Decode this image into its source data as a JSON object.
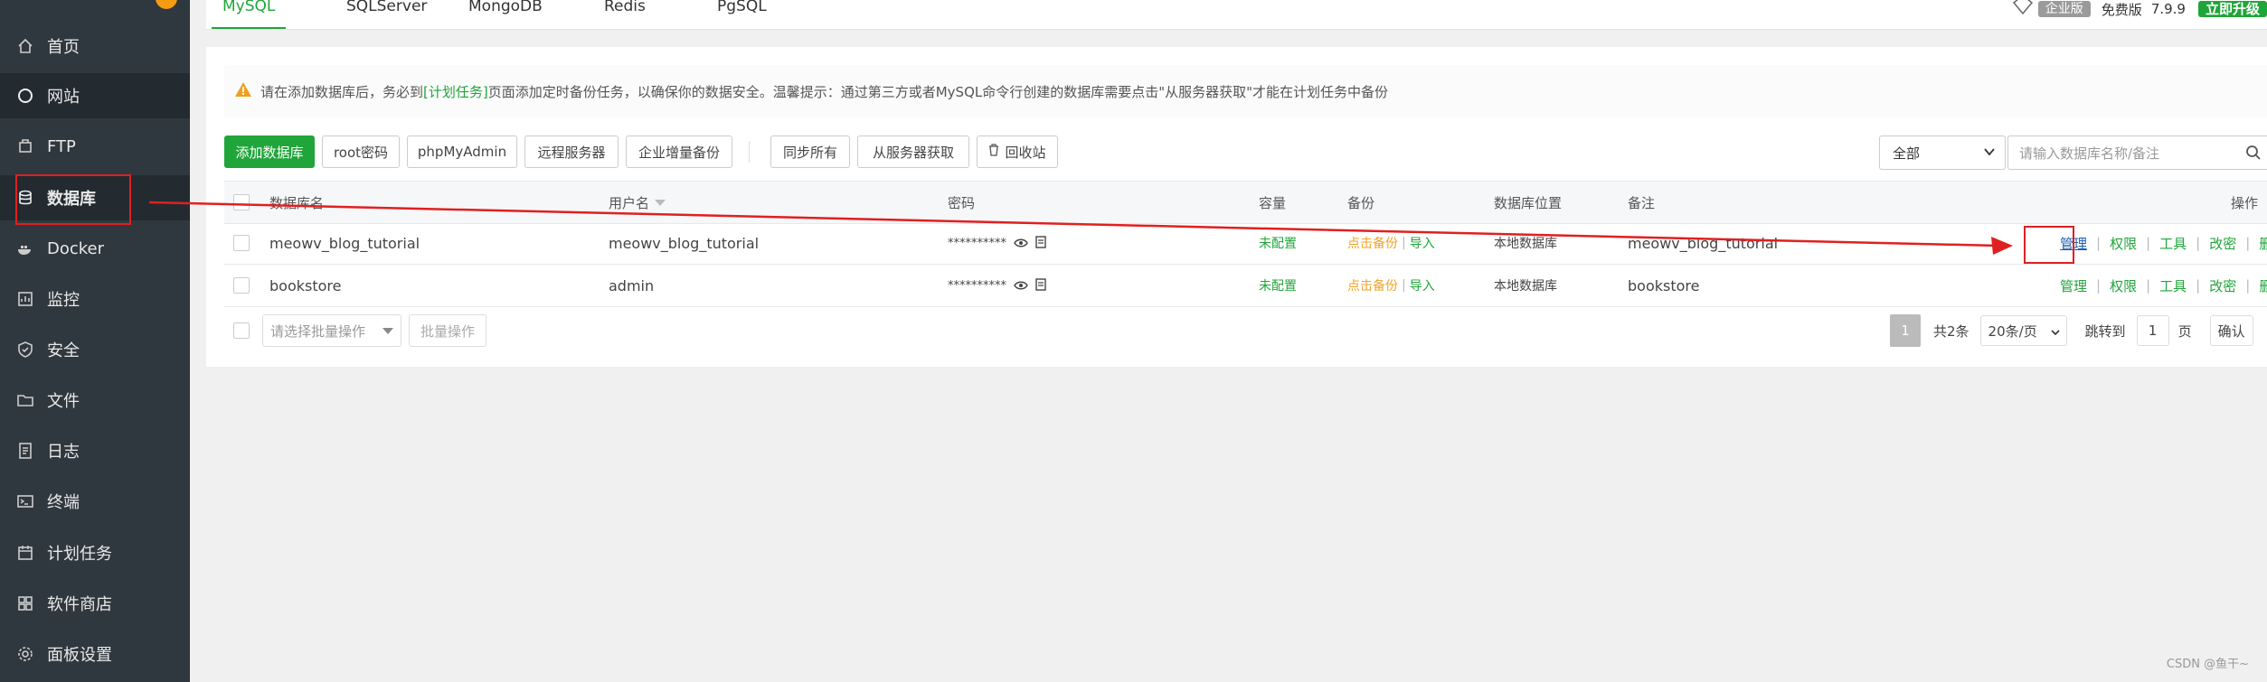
{
  "sidebar": {
    "items": [
      {
        "label": "首页",
        "icon": "home-icon"
      },
      {
        "label": "网站",
        "icon": "globe-icon"
      },
      {
        "label": "FTP",
        "icon": "ftp-icon"
      },
      {
        "label": "数据库",
        "icon": "database-icon"
      },
      {
        "label": "Docker",
        "icon": "docker-icon"
      },
      {
        "label": "监控",
        "icon": "monitor-icon"
      },
      {
        "label": "安全",
        "icon": "shield-icon"
      },
      {
        "label": "文件",
        "icon": "folder-icon"
      },
      {
        "label": "日志",
        "icon": "log-icon"
      },
      {
        "label": "终端",
        "icon": "terminal-icon"
      },
      {
        "label": "计划任务",
        "icon": "calendar-icon"
      },
      {
        "label": "软件商店",
        "icon": "apps-icon"
      },
      {
        "label": "面板设置",
        "icon": "gear-icon"
      }
    ]
  },
  "tabs": [
    "MySQL",
    "SQLServer",
    "MongoDB",
    "Redis",
    "PgSQL"
  ],
  "top_right": {
    "enterprise": "企业版",
    "free": "免费版",
    "version": "7.9.9",
    "upgrade": "立即升级"
  },
  "warning": {
    "before": "请在添加数据库后，务必到",
    "link": "[计划任务]",
    "after": "页面添加定时备份任务，以确保你的数据安全。温馨提示：通过第三方或者MySQL命令行创建的数据库需要点击\"从服务器获取\"才能在计划任务中备份"
  },
  "toolbar": {
    "add": "添加数据库",
    "root_pwd": "root密码",
    "phpmyadmin": "phpMyAdmin",
    "remote": "远程服务器",
    "incremental": "企业增量备份",
    "sync_all": "同步所有",
    "fetch": "从服务器获取",
    "recycle": "回收站",
    "filter_value": "全部",
    "search_placeholder": "请输入数据库名称/备注"
  },
  "table": {
    "headers": {
      "name": "数据库名",
      "user": "用户名",
      "password": "密码",
      "capacity": "容量",
      "backup": "备份",
      "location": "数据库位置",
      "remark": "备注",
      "actions": "操作"
    },
    "rows": [
      {
        "name": "meowv_blog_tutorial",
        "user": "meowv_blog_tutorial",
        "password": "**********",
        "capacity": "未配置",
        "backup": "点击备份",
        "import": "导入",
        "location": "本地数据库",
        "remark": "meowv_blog_tutorial"
      },
      {
        "name": "bookstore",
        "user": "admin",
        "password": "**********",
        "capacity": "未配置",
        "backup": "点击备份",
        "import": "导入",
        "location": "本地数据库",
        "remark": "bookstore"
      }
    ],
    "actions": [
      "管理",
      "权限",
      "工具",
      "改密",
      "删除"
    ]
  },
  "footer": {
    "batch_placeholder": "请选择批量操作",
    "batch_button": "批量操作",
    "current_page": "1",
    "total": "共2条",
    "page_size": "20条/页",
    "jump_label": "跳转到",
    "jump_value": "1",
    "page_unit": "页",
    "confirm": "确认"
  },
  "watermark": "CSDN @鱼干~",
  "colors": {
    "accent": "#20a53a",
    "sidebar": "#30383f",
    "annotation": "#e02020"
  }
}
